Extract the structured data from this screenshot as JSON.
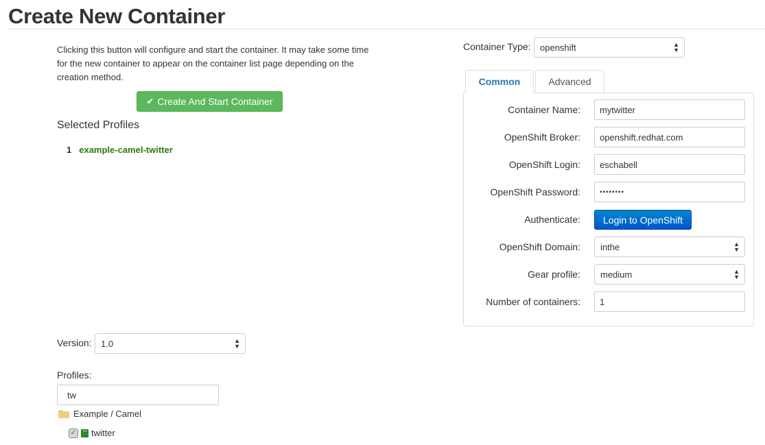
{
  "page": {
    "title": "Create New Container"
  },
  "left": {
    "info_text": "Clicking this button will configure and start the container. It may take some time for the new container to appear on the container list page depending on the creation method.",
    "create_button_label": "Create And Start Container",
    "create_button_icon": "check-icon",
    "selected_profiles_heading": "Selected Profiles",
    "selected_profiles": [
      {
        "index": "1",
        "name": "example-camel-twitter"
      }
    ],
    "version_label": "Version:",
    "version_value": "1.0",
    "profiles_label": "Profiles:",
    "profiles_filter_value": "tw",
    "tree": {
      "folder_label": "Example / Camel",
      "leaf_label": "twitter"
    }
  },
  "right": {
    "container_type_label": "Container Type:",
    "container_type_value": "openshift",
    "tabs": [
      {
        "label": "Common",
        "active": true
      },
      {
        "label": "Advanced",
        "active": false
      }
    ],
    "form": {
      "container_name": {
        "label": "Container Name:",
        "value": "mytwitter"
      },
      "broker": {
        "label": "OpenShift Broker:",
        "value": "openshift.redhat.com"
      },
      "login": {
        "label": "OpenShift Login:",
        "value": "eschabell"
      },
      "password": {
        "label": "OpenShift Password:",
        "value": "••••••••"
      },
      "authenticate": {
        "label": "Authenticate:",
        "button_label": "Login to OpenShift"
      },
      "domain": {
        "label": "OpenShift Domain:",
        "value": "inthe"
      },
      "gear_profile": {
        "label": "Gear profile:",
        "value": "medium"
      },
      "num_containers": {
        "label": "Number of containers:",
        "value": "1"
      }
    }
  },
  "colors": {
    "create_button": "#5cb85c",
    "login_button": "#0066cc",
    "profile_link": "#2b7a0b",
    "active_tab": "#2a7ab0"
  }
}
